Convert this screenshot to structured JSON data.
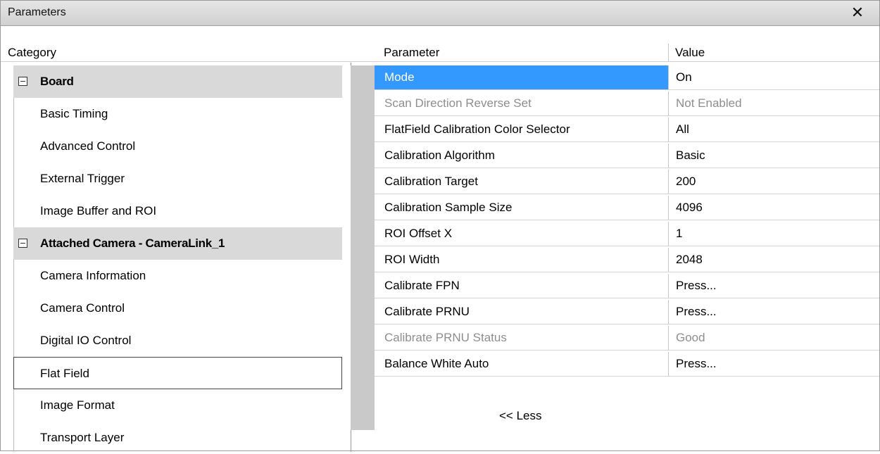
{
  "window": {
    "title": "Parameters"
  },
  "headers": {
    "category": "Category",
    "parameter": "Parameter",
    "value": "Value"
  },
  "categories": [
    {
      "label": "Board",
      "type": "group"
    },
    {
      "label": "Basic Timing",
      "type": "item"
    },
    {
      "label": "Advanced Control",
      "type": "item"
    },
    {
      "label": "External Trigger",
      "type": "item"
    },
    {
      "label": "Image Buffer and ROI",
      "type": "item"
    },
    {
      "label": "Attached Camera - CameraLink_1",
      "type": "group"
    },
    {
      "label": "Camera Information",
      "type": "item"
    },
    {
      "label": "Camera Control",
      "type": "item"
    },
    {
      "label": "Digital IO Control",
      "type": "item"
    },
    {
      "label": "Flat Field",
      "type": "item",
      "selected": true
    },
    {
      "label": "Image Format",
      "type": "item"
    },
    {
      "label": "Transport Layer",
      "type": "item"
    }
  ],
  "parameters": [
    {
      "name": "Mode",
      "value": "On",
      "selected": true
    },
    {
      "name": "Scan Direction Reverse Set",
      "value": "Not Enabled",
      "disabled": true
    },
    {
      "name": "FlatField Calibration Color Selector",
      "value": "All"
    },
    {
      "name": "Calibration Algorithm",
      "value": "Basic"
    },
    {
      "name": "Calibration Target",
      "value": "200"
    },
    {
      "name": "Calibration Sample Size",
      "value": "4096"
    },
    {
      "name": "ROI Offset X",
      "value": "1"
    },
    {
      "name": "ROI Width",
      "value": "2048"
    },
    {
      "name": "Calibrate FPN",
      "value": "Press..."
    },
    {
      "name": "Calibrate PRNU",
      "value": "Press..."
    },
    {
      "name": "Calibrate PRNU Status",
      "value": "Good",
      "disabled": true
    },
    {
      "name": "Balance White Auto",
      "value": "Press..."
    }
  ],
  "less_link": "<< Less",
  "colors": {
    "selection": "#3399ff",
    "group_bg": "#d9d9d9",
    "disabled_text": "#8e8e8e"
  }
}
